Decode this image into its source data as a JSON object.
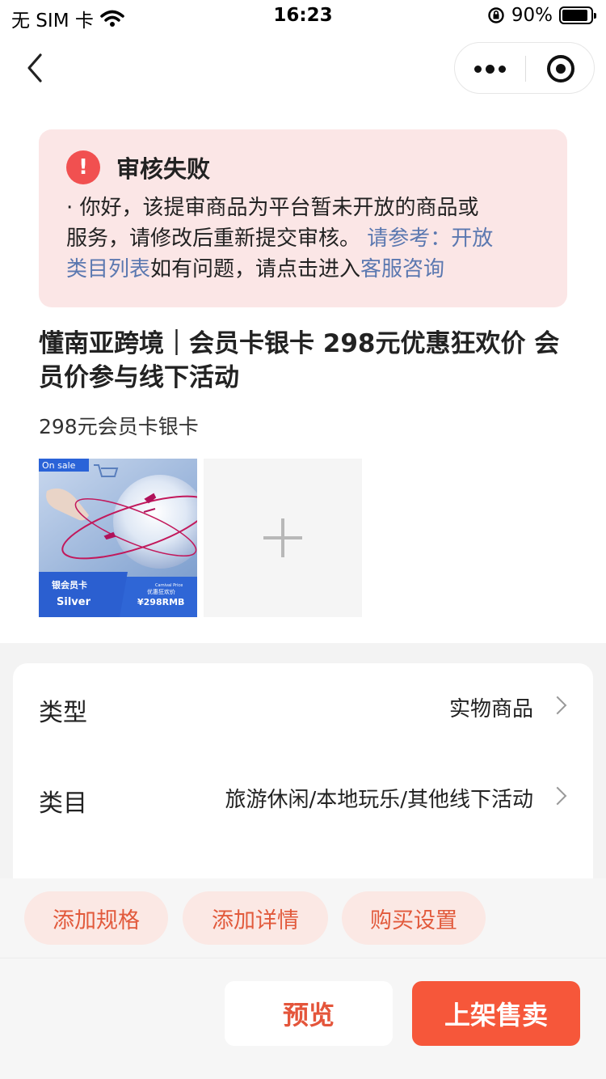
{
  "status_bar": {
    "carrier": "无 SIM 卡",
    "time": "16:23",
    "battery": "90%",
    "battery_level": 0.9
  },
  "nav": {
    "back_icon": "chevron-left-icon",
    "more_icon": "more-dots-icon",
    "close_icon": "target-icon"
  },
  "alert": {
    "title": "审核失败",
    "icon_symbol": "!",
    "line1": "· 你好，该提审商品为平台暂未开放的商品或",
    "line2_text": "服务，请修改后重新提交审核。 ",
    "line2_link": "请参考：开放",
    "line3_link": "类目列表",
    "line3_text": "如有问题，请点击进入",
    "line3_link2": "客服咨询"
  },
  "product": {
    "title": "懂南亚跨境｜会员卡银卡 298元优惠狂欢价 会员价参与线下活动",
    "subtitle": "298元会员卡银卡",
    "image_texts": {
      "badge": "On sale",
      "card_name": "银会员卡",
      "tier": "Silver",
      "carnival_en": "Carnival Price",
      "carnival_cn": "优惠狂欢价",
      "price": "¥298RMB"
    }
  },
  "form": {
    "rows": [
      {
        "label": "类型",
        "value": "实物商品"
      },
      {
        "label": "类目",
        "value": "旅游休闲/本地玩乐/其他线下活动"
      }
    ]
  },
  "actions": {
    "chips": [
      "添加规格",
      "添加详情",
      "购买设置"
    ],
    "preview": "预览",
    "publish": "上架售卖"
  },
  "colors": {
    "accent": "#f6573a",
    "alert_bg": "#fbe6e6",
    "alert_icon": "#f15050",
    "link": "#5b78b0"
  }
}
